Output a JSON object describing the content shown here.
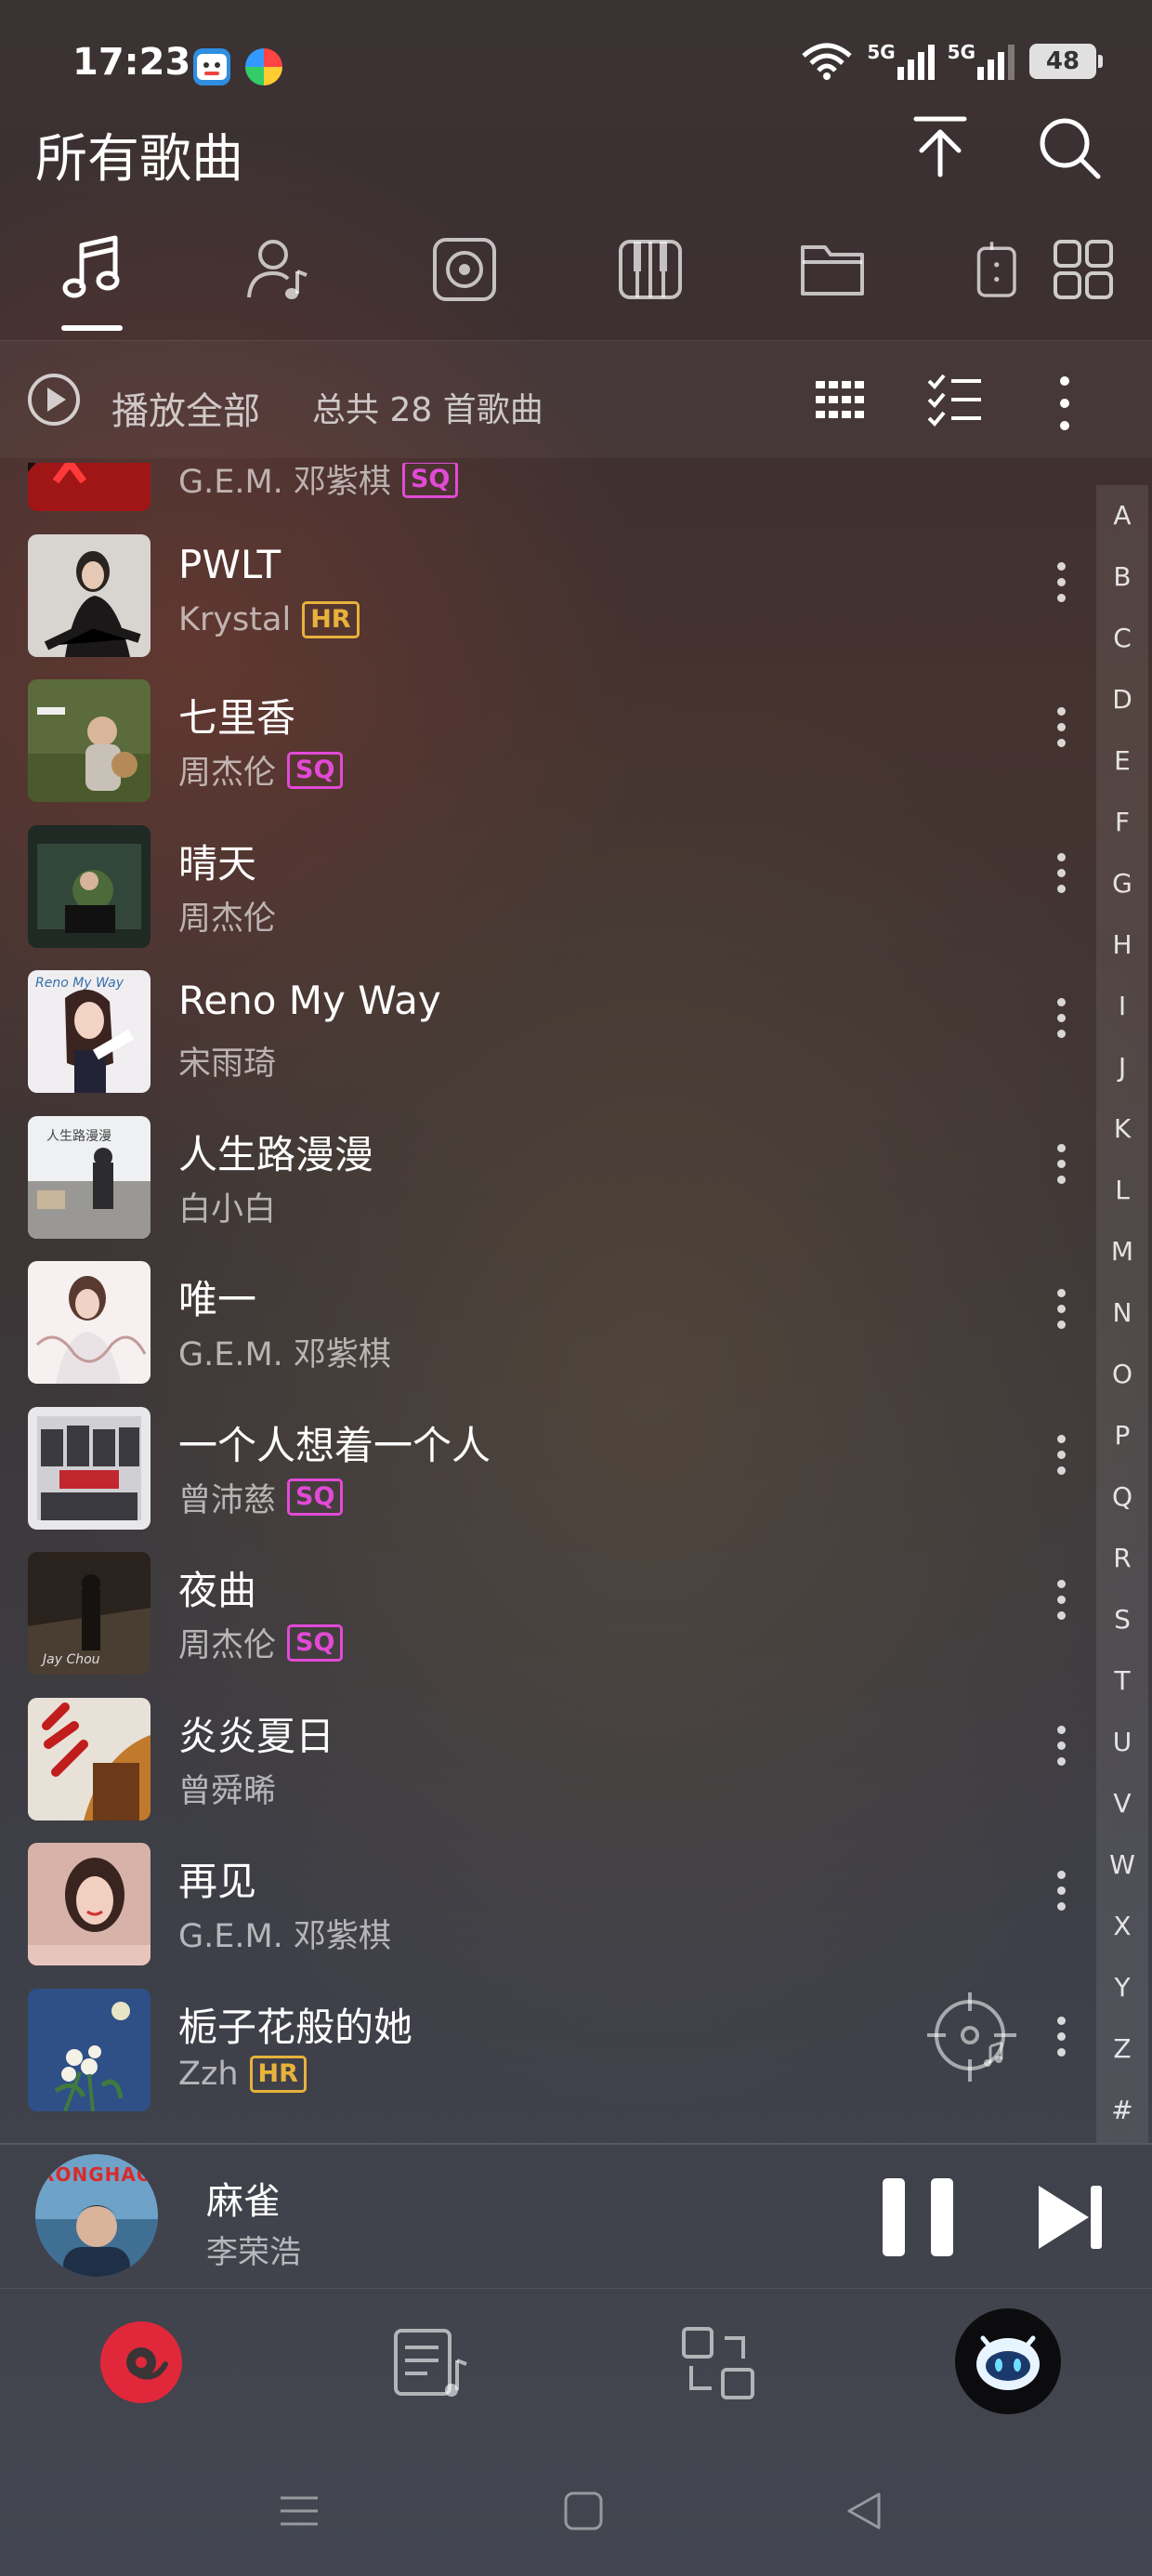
{
  "status_bar": {
    "time": "17:23",
    "network_1": "5G",
    "network_2": "5G",
    "battery": "48"
  },
  "header": {
    "title": "所有歌曲",
    "upload_icon": "upload-top-icon",
    "search_icon": "search-icon"
  },
  "tabs": [
    {
      "name": "songs",
      "icon": "music-note-icon",
      "active": true
    },
    {
      "name": "artists",
      "icon": "artist-icon"
    },
    {
      "name": "albums",
      "icon": "album-icon"
    },
    {
      "name": "genres",
      "icon": "piano-icon"
    },
    {
      "name": "folders",
      "icon": "folder-icon"
    },
    {
      "name": "more",
      "icon": "grid-icon"
    }
  ],
  "action_row": {
    "play_all_label": "播放全部",
    "count_label": "总共 28 首歌曲"
  },
  "songs": [
    {
      "title": "",
      "artist": "G.E.M. 邓紫棋",
      "badge": "SQ"
    },
    {
      "title": "PWLT",
      "artist": "Krystal",
      "badge": "HR"
    },
    {
      "title": "七里香",
      "artist": "周杰伦",
      "badge": "SQ"
    },
    {
      "title": "晴天",
      "artist": "周杰伦",
      "badge": ""
    },
    {
      "title": "Reno My Way",
      "artist": "宋雨琦",
      "badge": ""
    },
    {
      "title": "人生路漫漫",
      "artist": "白小白",
      "badge": ""
    },
    {
      "title": "唯一",
      "artist": "G.E.M. 邓紫棋",
      "badge": ""
    },
    {
      "title": "一个人想着一个人",
      "artist": "曾沛慈",
      "badge": "SQ"
    },
    {
      "title": "夜曲",
      "artist": "周杰伦",
      "badge": "SQ"
    },
    {
      "title": "炎炎夏日",
      "artist": "曾舜晞",
      "badge": ""
    },
    {
      "title": "再见",
      "artist": "G.E.M. 邓紫棋",
      "badge": ""
    },
    {
      "title": "栀子花般的她",
      "artist": "Zzh",
      "badge": "HR"
    }
  ],
  "alphabet": [
    "A",
    "B",
    "C",
    "D",
    "E",
    "F",
    "G",
    "H",
    "I",
    "J",
    "K",
    "L",
    "M",
    "N",
    "O",
    "P",
    "Q",
    "R",
    "S",
    "T",
    "U",
    "V",
    "W",
    "X",
    "Y",
    "Z",
    "#"
  ],
  "now_playing": {
    "title": "麻雀",
    "artist": "李荣浩",
    "cover_text": "RONGHAO"
  },
  "colors": {
    "accent_red": "#e0283a",
    "sq_badge": "#e24ad6",
    "hr_badge": "#e8b23b"
  }
}
